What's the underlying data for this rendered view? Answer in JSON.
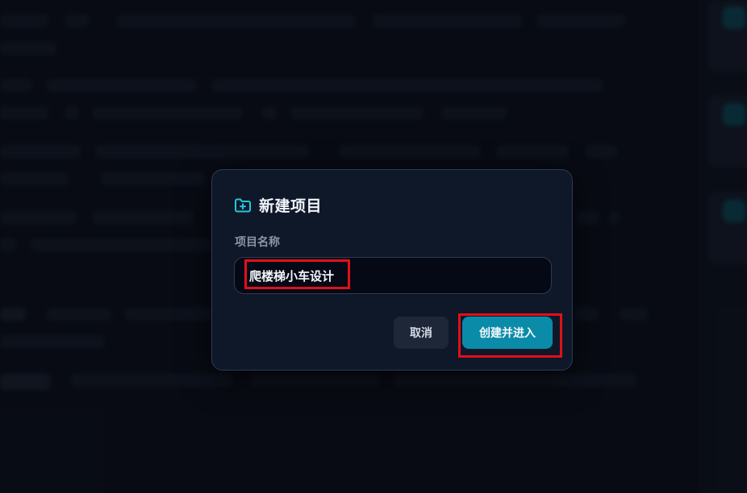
{
  "dialog": {
    "icon": "folder-plus-icon",
    "title": "新建项目",
    "field_label": "项目名称",
    "input_value": "爬楼梯小车设计",
    "cancel_label": "取消",
    "create_label": "创建并进入"
  },
  "colors": {
    "accent": "#0a8ba8",
    "icon": "#22c7e0",
    "highlight": "#e0101a"
  }
}
